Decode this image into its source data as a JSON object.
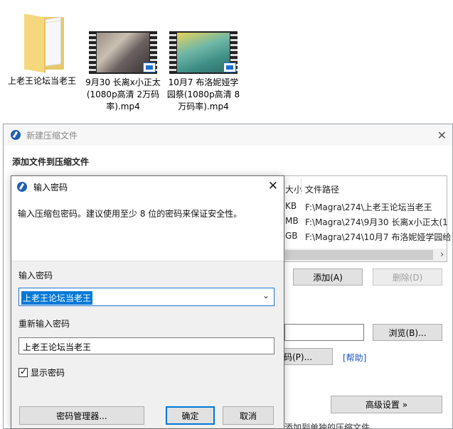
{
  "desktop": {
    "files": [
      {
        "name": "上老王论坛当老王",
        "type": "folder"
      },
      {
        "name": "9月30 长离x小正太(1080p高清 2万码率).mp4",
        "type": "video"
      },
      {
        "name": "10月7 布洛妮娅学园祭(1080p高清 8万码率).mp4",
        "type": "video"
      }
    ]
  },
  "archive_window": {
    "title": "新建压缩文件",
    "heading": "添加文件到压缩文件",
    "columns": {
      "size": "大小",
      "path": "文件路径"
    },
    "rows": [
      {
        "size": "KB",
        "path": "F:\\Magra\\274\\上老王论坛当老王"
      },
      {
        "size": "MB",
        "path": "F:\\Magra\\274\\9月30 长离x小正太(1"
      },
      {
        "size": "GB",
        "path": "F:\\Magra\\274\\10月7 布洛妮娅学园给"
      }
    ],
    "add_button": "添加(A)",
    "delete_button": "删除(D)",
    "browse_button": "浏览(B)...",
    "password_button": "码(P)...",
    "help_link": "[帮助]",
    "advanced_button": "高级设置 »",
    "bottom_text": "添加到单独的压缩文件"
  },
  "password_dialog": {
    "title": "输入密码",
    "hint": "输入压缩包密码。建议使用至少 8 位的密码来保证安全性。",
    "password_label": "输入密码",
    "password_value": "上老王论坛当老王",
    "confirm_label": "重新输入密码",
    "confirm_value": "上老王论坛当老王",
    "show_password_label": "显示密码",
    "show_password_checked": true,
    "manager_button": "密码管理器...",
    "ok_button": "确定",
    "cancel_button": "取消"
  },
  "colors": {
    "accent": "#0078d7",
    "link": "#1a56c4"
  }
}
